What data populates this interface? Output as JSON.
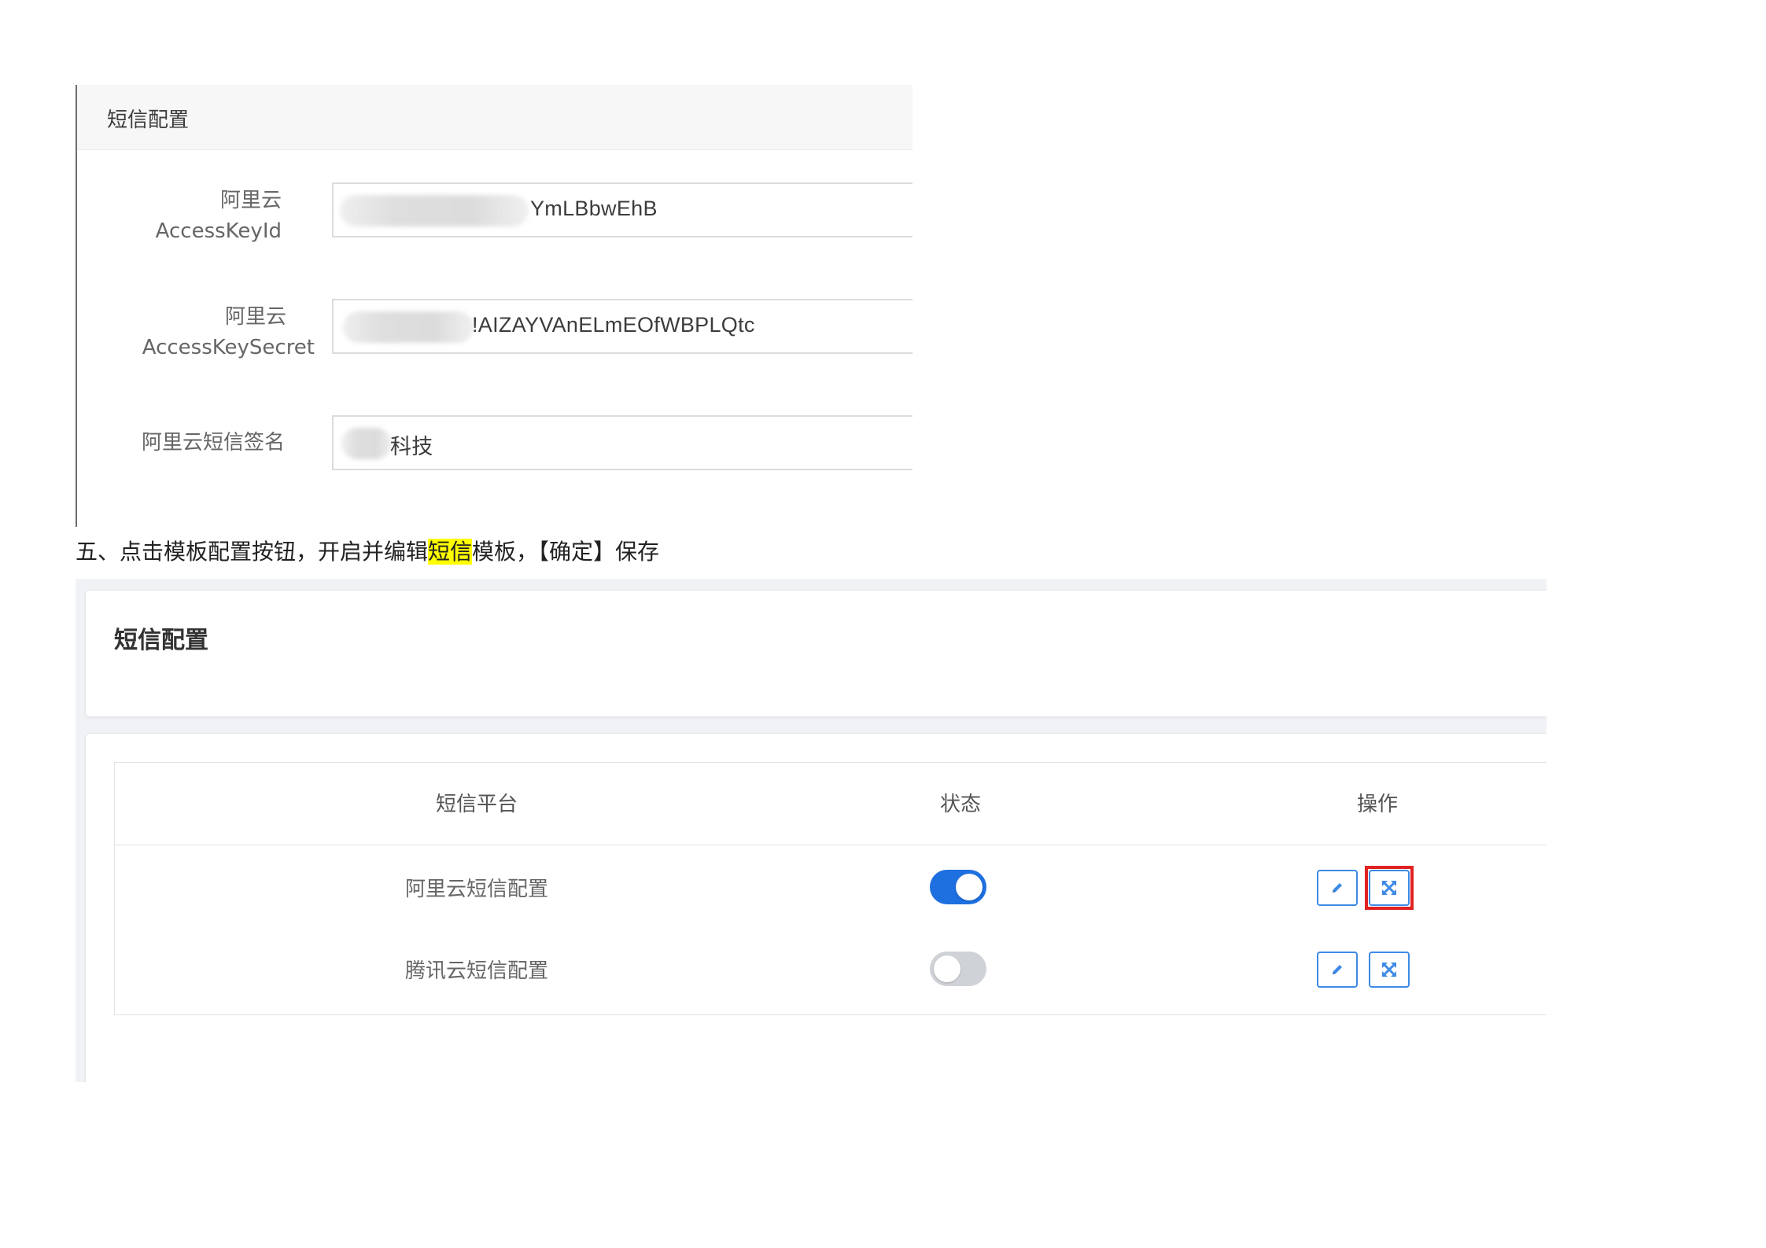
{
  "form_panel": {
    "title": "短信配置",
    "fields": [
      {
        "label_line1": "阿里云",
        "label_line2": "AccessKeyId",
        "value": "YmLBbwEhB"
      },
      {
        "label_line1": "阿里云",
        "label_line2": "AccessKeySecret",
        "value": "!AIZAYVAnELmEOfWBPLQtc"
      },
      {
        "label_line1": "阿里云短信签名",
        "label_line2": "",
        "value": "科技"
      }
    ]
  },
  "caption": {
    "before": "五、点击模板配置按钮，开启并编辑",
    "highlight": "短信",
    "after": "模板，【确定】保存"
  },
  "table_panel": {
    "title": "短信配置",
    "columns": [
      "短信平台",
      "状态",
      "操作"
    ],
    "rows": [
      {
        "platform": "阿里云短信配置",
        "enabled": true
      },
      {
        "platform": "腾讯云短信配置",
        "enabled": false
      }
    ],
    "icons": {
      "edit": "pencil-icon",
      "template": "expand-arrows-icon"
    },
    "colors": {
      "accent": "#1e6fe0",
      "highlight_box": "#e02222",
      "caption_highlight": "#ffff00"
    }
  }
}
